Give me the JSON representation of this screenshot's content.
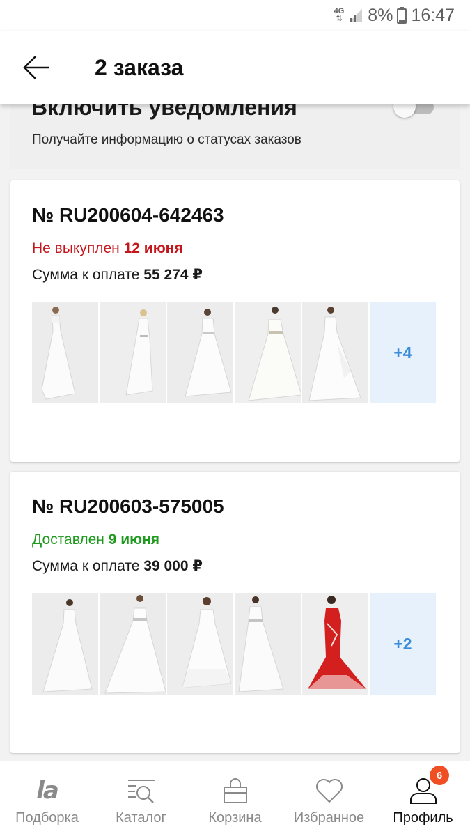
{
  "status_bar": {
    "network": "4G",
    "battery": "8%",
    "time": "16:47"
  },
  "header": {
    "title": "2 заказа"
  },
  "notifications": {
    "title": "Включить уведомления",
    "subtitle": "Получайте информацию о статусах заказов",
    "enabled": false
  },
  "orders": [
    {
      "number": "№ RU200604-642463",
      "status_text": "Не выкуплен",
      "status_date": "12 июня",
      "status_color": "#c4161c",
      "sum_label": "Сумма к оплате",
      "sum_value": "55 274 ₽",
      "more": "+4",
      "thumbs": [
        "white-dress",
        "white-dress",
        "white-dress",
        "white-dress",
        "white-dress"
      ]
    },
    {
      "number": "№ RU200603-575005",
      "status_text": "Доставлен",
      "status_date": "9 июня",
      "status_color": "#1e9a1e",
      "sum_label": "Сумма к оплате",
      "sum_value": "39 000 ₽",
      "more": "+2",
      "thumbs": [
        "white-dress",
        "white-dress",
        "white-dress",
        "white-dress",
        "red-dress"
      ]
    }
  ],
  "bottom_nav": {
    "items": [
      {
        "label": "Подборка",
        "icon": "lamoda-logo-icon",
        "logo_text": "la"
      },
      {
        "label": "Каталог",
        "icon": "catalog-search-icon"
      },
      {
        "label": "Корзина",
        "icon": "cart-bag-icon"
      },
      {
        "label": "Избранное",
        "icon": "heart-icon"
      },
      {
        "label": "Профиль",
        "icon": "profile-icon",
        "badge": "6",
        "active": true
      }
    ]
  }
}
